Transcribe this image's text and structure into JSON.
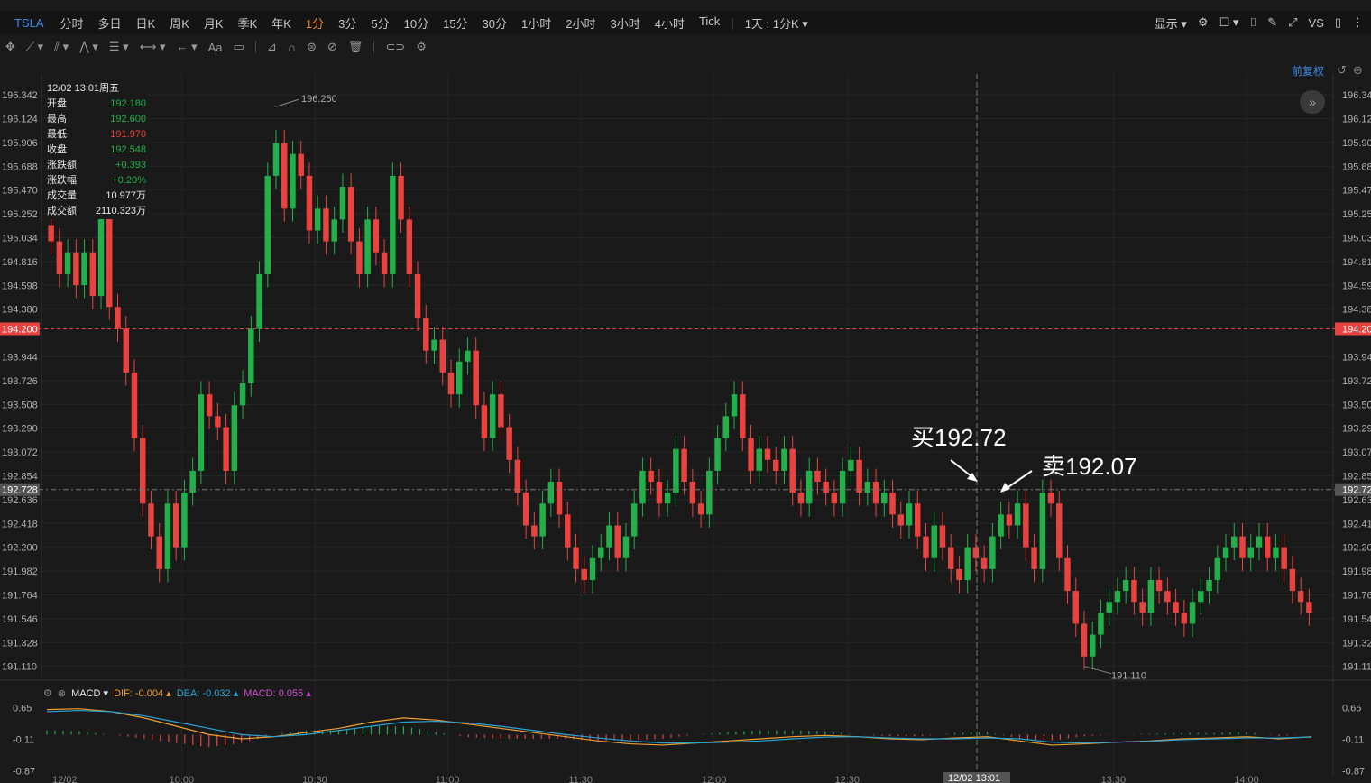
{
  "topbar": {
    "symbol": "TSLA",
    "intervals": [
      "分时",
      "多日",
      "日K",
      "周K",
      "月K",
      "季K",
      "年K",
      "1分",
      "3分",
      "5分",
      "10分",
      "15分",
      "30分",
      "1小时",
      "2小时",
      "3小时",
      "4小时",
      "Tick"
    ],
    "active_interval": "1分",
    "range_label": "1天 : 1分K",
    "display_label": "显示",
    "vs_label": "VS"
  },
  "toolbar": {
    "text_tool_label": "Aa"
  },
  "adjust_label": "前复权",
  "info_box": {
    "datetime": "12/02 13:01周五",
    "rows": [
      {
        "label": "开盘",
        "value": "192.180",
        "color": "g"
      },
      {
        "label": "最高",
        "value": "192.600",
        "color": "g"
      },
      {
        "label": "最低",
        "value": "191.970",
        "color": "r"
      },
      {
        "label": "收盘",
        "value": "192.548",
        "color": "g"
      },
      {
        "label": "涨跌额",
        "value": "+0.393",
        "color": "g"
      },
      {
        "label": "涨跌幅",
        "value": "+0.20%",
        "color": "g"
      },
      {
        "label": "成交量",
        "value": "10.977万",
        "color": "w"
      },
      {
        "label": "成交额",
        "value": "2110.323万",
        "color": "w"
      }
    ]
  },
  "macd_legend": {
    "name": "MACD",
    "dif_label": "DIF:",
    "dif_value": "-0.004",
    "dea_label": "DEA:",
    "dea_value": "-0.032",
    "macd_label": "MACD:",
    "macd_value": "0.055"
  },
  "colors": {
    "up": "#22b04a",
    "down": "#e8433f",
    "dif": "#f0a030",
    "dea": "#29a3d6",
    "macd": "#d04fd0",
    "accent": "#f08a24",
    "blue": "#3d8be6"
  },
  "chart_data": [
    {
      "type": "candlestick",
      "symbol": "TSLA",
      "y_ticks": [
        "196.342",
        "196.124",
        "195.906",
        "195.688",
        "195.470",
        "195.252",
        "195.034",
        "194.816",
        "194.598",
        "194.380",
        "193.944",
        "193.726",
        "193.508",
        "193.290",
        "193.072",
        "192.854",
        "192.636",
        "192.418",
        "192.200",
        "191.982",
        "191.764",
        "191.546",
        "191.328",
        "191.110"
      ],
      "ylim": [
        191.0,
        196.45
      ],
      "x_tick_labels": [
        "12/02",
        "10:00",
        "10:30",
        "11:00",
        "11:30",
        "12:00",
        "12:30",
        "13:00",
        "13:30",
        "14:00"
      ],
      "max_label": "196.250",
      "min_label": "191.110",
      "reference_line": {
        "value": 194.2,
        "label": "194.200"
      },
      "crosshair": {
        "price": 192.728,
        "price_label": "192.728",
        "time_label": "12/02 13:01"
      },
      "annotations": [
        {
          "text": "买192.72",
          "price": 192.72
        },
        {
          "text": "卖192.07",
          "price": 192.07
        }
      ],
      "closes": [
        195.0,
        194.7,
        194.9,
        194.6,
        194.9,
        194.5,
        195.3,
        194.4,
        194.2,
        193.8,
        193.2,
        192.6,
        192.3,
        192.0,
        192.6,
        192.2,
        192.7,
        192.9,
        193.6,
        193.4,
        193.3,
        192.9,
        193.5,
        193.7,
        194.2,
        194.7,
        195.6,
        195.9,
        195.3,
        195.8,
        195.6,
        195.1,
        195.3,
        195.0,
        195.2,
        195.5,
        195.0,
        194.7,
        195.2,
        194.9,
        194.7,
        195.6,
        195.2,
        194.7,
        194.3,
        194.0,
        194.1,
        193.8,
        193.6,
        193.9,
        194.0,
        193.5,
        193.2,
        193.6,
        193.3,
        193.0,
        192.7,
        192.4,
        192.3,
        192.6,
        192.8,
        192.5,
        192.2,
        192.0,
        191.9,
        192.1,
        192.2,
        192.4,
        192.1,
        192.3,
        192.6,
        192.9,
        192.8,
        192.6,
        192.7,
        193.1,
        192.8,
        192.6,
        192.5,
        192.9,
        193.2,
        193.4,
        193.6,
        193.2,
        192.9,
        193.1,
        193.0,
        192.9,
        193.1,
        192.7,
        192.6,
        192.9,
        192.8,
        192.7,
        192.6,
        192.9,
        193.0,
        192.7,
        192.8,
        192.6,
        192.7,
        192.5,
        192.4,
        192.6,
        192.3,
        192.1,
        192.4,
        192.2,
        192.0,
        191.9,
        192.2,
        192.1,
        192.0,
        192.3,
        192.5,
        192.4,
        192.6,
        192.2,
        192.0,
        192.7,
        192.6,
        192.1,
        191.8,
        191.5,
        191.2,
        191.4,
        191.6,
        191.7,
        191.8,
        191.9,
        191.7,
        191.6,
        191.9,
        191.8,
        191.7,
        191.6,
        191.5,
        191.7,
        191.8,
        191.9,
        192.1,
        192.2,
        192.3,
        192.1,
        192.2,
        192.3,
        192.1,
        192.2,
        192.0,
        191.8,
        191.7,
        191.6
      ],
      "macd": {
        "y_ticks": [
          "0.65",
          "-0.11",
          "-0.87"
        ],
        "ylim": [
          -0.9,
          0.7
        ],
        "dif": [
          0.6,
          0.62,
          0.55,
          0.4,
          0.2,
          0.0,
          -0.1,
          -0.05,
          0.05,
          0.15,
          0.3,
          0.4,
          0.35,
          0.25,
          0.15,
          0.05,
          -0.05,
          -0.15,
          -0.22,
          -0.25,
          -0.2,
          -0.15,
          -0.1,
          -0.05,
          -0.02,
          -0.05,
          -0.1,
          -0.12,
          -0.08,
          -0.05,
          -0.15,
          -0.25,
          -0.22,
          -0.18,
          -0.15,
          -0.1,
          -0.08,
          -0.05,
          -0.1,
          -0.05
        ],
        "dea": [
          0.55,
          0.58,
          0.55,
          0.45,
          0.3,
          0.15,
          0.0,
          -0.05,
          0.0,
          0.1,
          0.2,
          0.3,
          0.32,
          0.28,
          0.2,
          0.1,
          0.0,
          -0.08,
          -0.15,
          -0.2,
          -0.2,
          -0.18,
          -0.15,
          -0.1,
          -0.06,
          -0.05,
          -0.08,
          -0.1,
          -0.1,
          -0.08,
          -0.1,
          -0.18,
          -0.2,
          -0.18,
          -0.16,
          -0.12,
          -0.1,
          -0.08,
          -0.08,
          -0.06
        ]
      }
    }
  ]
}
